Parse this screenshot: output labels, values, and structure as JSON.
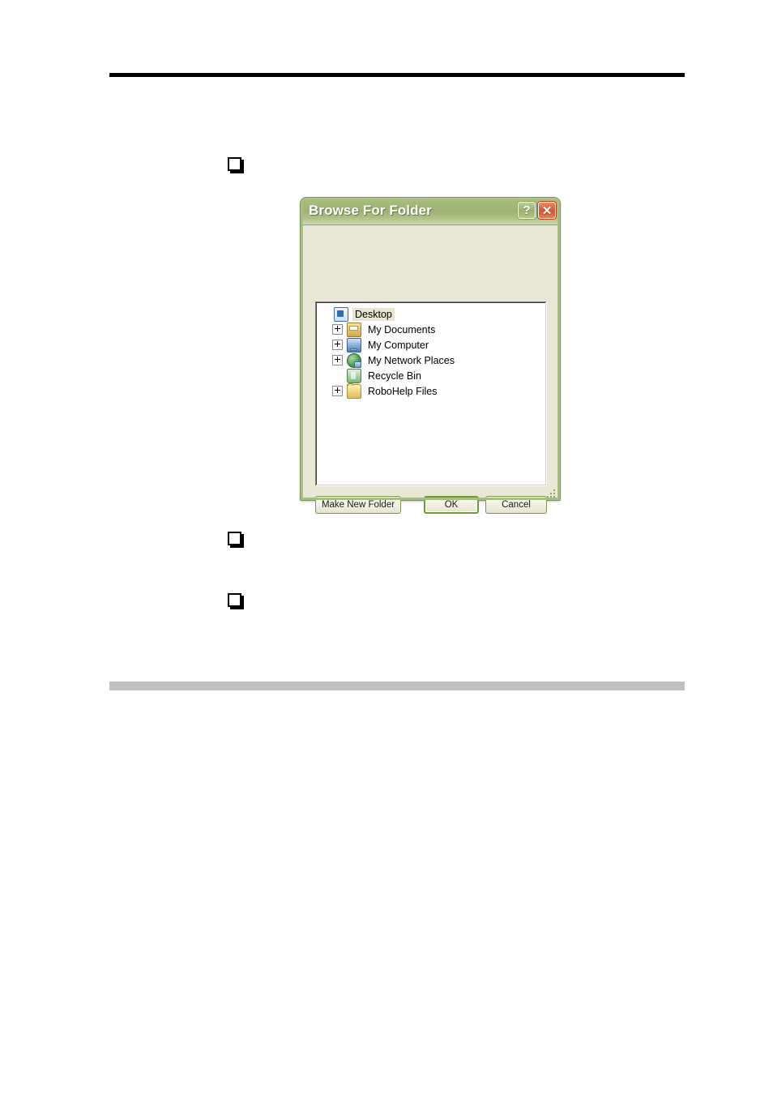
{
  "page": {
    "rules": {
      "top_rule": "header-rule",
      "bottom_rule": "footer-rule"
    },
    "bullets": [
      {
        "marker": "square-bullet",
        "text": ""
      },
      {
        "marker": "square-bullet",
        "text": ""
      },
      {
        "marker": "square-bullet",
        "text": ""
      }
    ]
  },
  "dialog": {
    "title": "Browse For Folder",
    "titlebar_buttons": [
      {
        "name": "help-button",
        "glyph": "?"
      },
      {
        "name": "close-button",
        "glyph": "✕"
      }
    ],
    "prompt": "",
    "tree": {
      "items": [
        {
          "label": "Desktop",
          "icon": "desktop-icon",
          "level": 0,
          "expandable": false,
          "expanded": false,
          "selected": true
        },
        {
          "label": "My Documents",
          "icon": "documents-folder-icon",
          "level": 1,
          "expandable": true,
          "expanded": false,
          "selected": false
        },
        {
          "label": "My Computer",
          "icon": "computer-icon",
          "level": 1,
          "expandable": true,
          "expanded": false,
          "selected": false
        },
        {
          "label": "My Network Places",
          "icon": "network-icon",
          "level": 1,
          "expandable": true,
          "expanded": false,
          "selected": false
        },
        {
          "label": "Recycle Bin",
          "icon": "recycle-bin-icon",
          "level": 1,
          "expandable": false,
          "expanded": false,
          "selected": false
        },
        {
          "label": "RoboHelp Files",
          "icon": "folder-icon",
          "level": 1,
          "expandable": true,
          "expanded": false,
          "selected": false
        }
      ]
    },
    "buttons": {
      "make_new_folder": "Make New Folder",
      "ok": "OK",
      "cancel": "Cancel"
    }
  },
  "colors": {
    "titlebar_green": "#9db373",
    "frame_green": "#a8bd80",
    "dialog_face": "#e9e7d6",
    "close_red": "#d4552c",
    "default_button_border": "#6f9c33",
    "selection_highlight": "#e8e4d0",
    "footer_gray": "#c0c0c0"
  }
}
